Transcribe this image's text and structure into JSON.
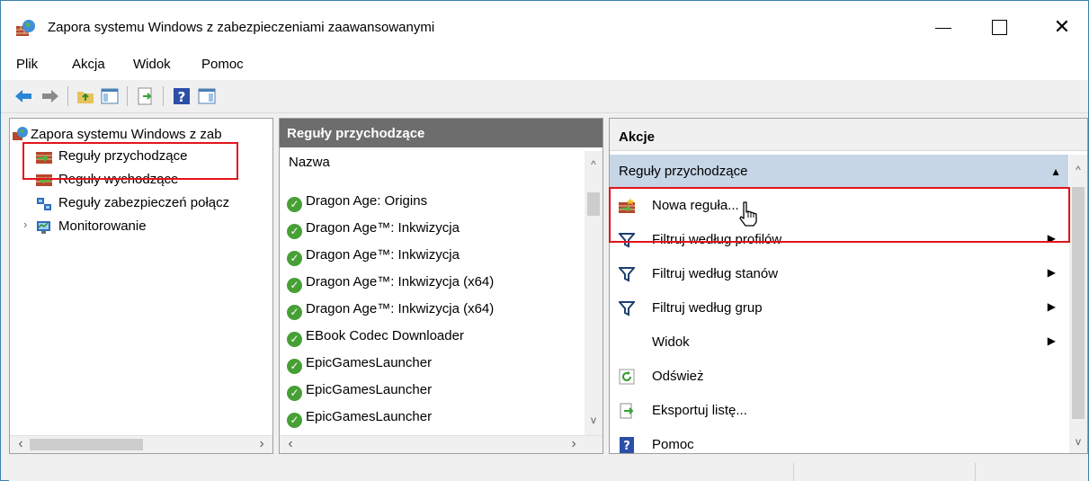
{
  "window": {
    "title": "Zapora systemu Windows z zabezpieczeniami zaawansowanymi"
  },
  "menu": [
    {
      "label": "Plik"
    },
    {
      "label": "Akcja"
    },
    {
      "label": "Widok"
    },
    {
      "label": "Pomoc"
    }
  ],
  "tree": {
    "root": "Zapora systemu Windows z zab",
    "items": [
      {
        "label": "Reguły przychodzące",
        "icon": "inbound-rules-icon"
      },
      {
        "label": "Reguły wychodzące",
        "icon": "outbound-rules-icon"
      },
      {
        "label": "Reguły zabezpieczeń połącz",
        "icon": "connection-security-icon"
      },
      {
        "label": "Monitorowanie",
        "icon": "monitor-icon"
      }
    ]
  },
  "rules_pane": {
    "header": "Reguły przychodzące",
    "column": "Nazwa",
    "rows": [
      "Dragon Age: Origins",
      "Dragon Age™: Inkwizycja",
      "Dragon Age™: Inkwizycja",
      "Dragon Age™: Inkwizycja (x64)",
      "Dragon Age™: Inkwizycja (x64)",
      "EBook Codec Downloader",
      "EpicGamesLauncher",
      "EpicGamesLauncher",
      "EpicGamesLauncher"
    ]
  },
  "actions_pane": {
    "header": "Akcje",
    "section": "Reguły przychodzące",
    "items": [
      {
        "label": "Nowa reguła...",
        "icon": "new-rule-icon"
      },
      {
        "label": "Filtruj według profilów",
        "icon": "filter-icon",
        "submenu": true
      },
      {
        "label": "Filtruj według stanów",
        "icon": "filter-icon",
        "submenu": true
      },
      {
        "label": "Filtruj według grup",
        "icon": "filter-icon",
        "submenu": true
      },
      {
        "label": "Widok",
        "icon": "",
        "submenu": true
      },
      {
        "label": "Odśwież",
        "icon": "refresh-icon"
      },
      {
        "label": "Eksportuj listę...",
        "icon": "export-icon"
      },
      {
        "label": "Pomoc",
        "icon": "help-icon"
      }
    ]
  },
  "colors": {
    "highlight": "#e3141c",
    "section": "#c6d6e6",
    "header": "#6d6d6d",
    "check": "#47a035"
  }
}
